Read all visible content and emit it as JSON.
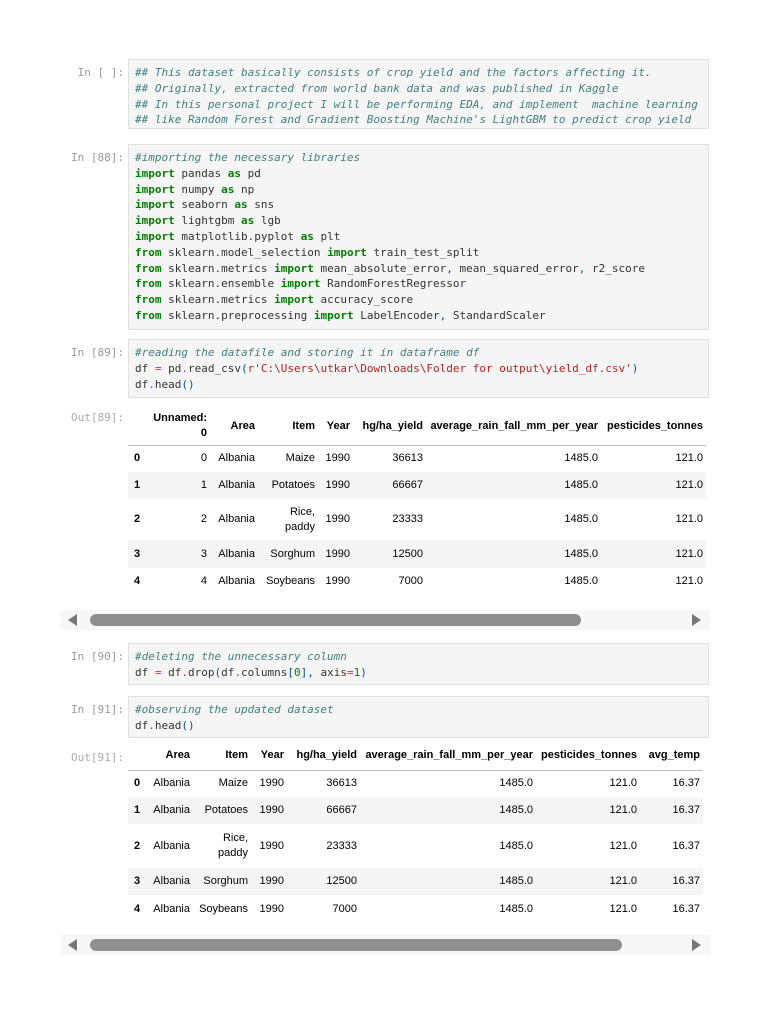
{
  "cells": [
    {
      "prompt": "In [ ]:",
      "lines": [
        [
          [
            "## This dataset basically consists of crop yield and the factors affecting it.",
            "c"
          ]
        ],
        [
          [
            "## Originally, extracted from world bank data and was published in Kaggle",
            "c"
          ]
        ],
        [
          [
            "## In this personal project I will be performing EDA, and implement  machine learning",
            "c"
          ]
        ],
        [
          [
            "## like Random Forest and Gradient Boosting Machine's LightGBM to predict crop yield",
            "c"
          ]
        ]
      ]
    },
    {
      "prompt": "In [88]:",
      "lines": [
        [
          [
            "#importing the necessary libraries",
            "c"
          ]
        ],
        [
          [
            "import",
            "k"
          ],
          [
            " pandas ",
            ""
          ],
          [
            "as",
            "k"
          ],
          [
            " pd",
            ""
          ]
        ],
        [
          [
            "import",
            "k"
          ],
          [
            " numpy ",
            ""
          ],
          [
            "as",
            "k"
          ],
          [
            " np",
            ""
          ]
        ],
        [
          [
            "import",
            "k"
          ],
          [
            " seaborn ",
            ""
          ],
          [
            "as",
            "k"
          ],
          [
            " sns",
            ""
          ]
        ],
        [
          [
            "import",
            "k"
          ],
          [
            " lightgbm ",
            ""
          ],
          [
            "as",
            "k"
          ],
          [
            " lgb",
            ""
          ]
        ],
        [
          [
            "import",
            "k"
          ],
          [
            " matplotlib.pyplot ",
            ""
          ],
          [
            "as",
            "k"
          ],
          [
            " plt",
            ""
          ]
        ],
        [
          [
            "from",
            "k"
          ],
          [
            " sklearn.model_selection ",
            ""
          ],
          [
            "import",
            "k"
          ],
          [
            " train_test_split",
            ""
          ]
        ],
        [
          [
            "from",
            "k"
          ],
          [
            " sklearn.metrics ",
            ""
          ],
          [
            "import",
            "k"
          ],
          [
            " mean_absolute_error",
            ""
          ],
          [
            ",",
            "p"
          ],
          [
            " mean_squared_error",
            ""
          ],
          [
            ",",
            "p"
          ],
          [
            " r2_score",
            ""
          ]
        ],
        [
          [
            "from",
            "k"
          ],
          [
            " sklearn.ensemble ",
            ""
          ],
          [
            "import",
            "k"
          ],
          [
            " RandomForestRegressor",
            ""
          ]
        ],
        [
          [
            "from",
            "k"
          ],
          [
            " sklearn.metrics ",
            ""
          ],
          [
            "import",
            "k"
          ],
          [
            " accuracy_score",
            ""
          ]
        ],
        [
          [
            "from",
            "k"
          ],
          [
            " sklearn.preprocessing ",
            ""
          ],
          [
            "import",
            "k"
          ],
          [
            " LabelEncoder",
            ""
          ],
          [
            ",",
            "p"
          ],
          [
            " StandardScaler",
            ""
          ]
        ]
      ]
    },
    {
      "prompt": "In [89]:",
      "lines": [
        [
          [
            "#reading the datafile and storing it in dataframe df",
            "c"
          ]
        ],
        [
          [
            "df ",
            ""
          ],
          [
            "=",
            "o"
          ],
          [
            " pd",
            ""
          ],
          [
            ".",
            "o"
          ],
          [
            "read_csv",
            ""
          ],
          [
            "(",
            "p"
          ],
          [
            "r'C:\\Users\\utkar\\Downloads\\Folder for output\\yield_df.csv'",
            "s"
          ],
          [
            ")",
            "p"
          ]
        ],
        [
          [
            "df",
            ""
          ],
          [
            ".",
            "o"
          ],
          [
            "head",
            ""
          ],
          [
            "()",
            "p"
          ]
        ]
      ]
    },
    {
      "prompt": "In [90]:",
      "lines": [
        [
          [
            "#deleting the unnecessary column",
            "c"
          ]
        ],
        [
          [
            "df ",
            ""
          ],
          [
            "=",
            "o"
          ],
          [
            " df",
            ""
          ],
          [
            ".",
            "o"
          ],
          [
            "drop",
            ""
          ],
          [
            "(",
            "p"
          ],
          [
            "df",
            ""
          ],
          [
            ".",
            "o"
          ],
          [
            "columns",
            ""
          ],
          [
            "[",
            "p"
          ],
          [
            "0",
            "k2"
          ],
          [
            "]",
            "p"
          ],
          [
            ",",
            "p"
          ],
          [
            " axis",
            ""
          ],
          [
            "=",
            "o"
          ],
          [
            "1",
            "k2"
          ],
          [
            ")",
            "p"
          ]
        ]
      ]
    },
    {
      "prompt": "In [91]:",
      "lines": [
        [
          [
            "#observing the updated dataset",
            "c"
          ]
        ],
        [
          [
            "df",
            ""
          ],
          [
            ".",
            "o"
          ],
          [
            "head",
            ""
          ],
          [
            "()",
            "p"
          ]
        ]
      ]
    }
  ],
  "outputs": [
    {
      "prompt": "Out[89]:",
      "columns": [
        "",
        "Unnamed: 0",
        "Area",
        "Item",
        "Year",
        "hg/ha_yield",
        "average_rain_fall_mm_per_year",
        "pesticides_tonnes"
      ],
      "rows": [
        [
          "0",
          "0",
          "Albania",
          "Maize",
          "1990",
          "36613",
          "1485.0",
          "121.0"
        ],
        [
          "1",
          "1",
          "Albania",
          "Potatoes",
          "1990",
          "66667",
          "1485.0",
          "121.0"
        ],
        [
          "2",
          "2",
          "Albania",
          "Rice, paddy",
          "1990",
          "23333",
          "1485.0",
          "121.0"
        ],
        [
          "3",
          "3",
          "Albania",
          "Sorghum",
          "1990",
          "12500",
          "1485.0",
          "121.0"
        ],
        [
          "4",
          "4",
          "Albania",
          "Soybeans",
          "1990",
          "7000",
          "1485.0",
          "121.0"
        ]
      ],
      "scroll_fraction": 0.83
    },
    {
      "prompt": "Out[91]:",
      "columns": [
        "",
        "Area",
        "Item",
        "Year",
        "hg/ha_yield",
        "average_rain_fall_mm_per_year",
        "pesticides_tonnes",
        "avg_temp"
      ],
      "rows": [
        [
          "0",
          "Albania",
          "Maize",
          "1990",
          "36613",
          "1485.0",
          "121.0",
          "16.37"
        ],
        [
          "1",
          "Albania",
          "Potatoes",
          "1990",
          "66667",
          "1485.0",
          "121.0",
          "16.37"
        ],
        [
          "2",
          "Albania",
          "Rice, paddy",
          "1990",
          "23333",
          "1485.0",
          "121.0",
          "16.37"
        ],
        [
          "3",
          "Albania",
          "Sorghum",
          "1990",
          "12500",
          "1485.0",
          "121.0",
          "16.37"
        ],
        [
          "4",
          "Albania",
          "Soybeans",
          "1990",
          "7000",
          "1485.0",
          "121.0",
          "16.37"
        ]
      ],
      "scroll_fraction": 0.9
    }
  ]
}
